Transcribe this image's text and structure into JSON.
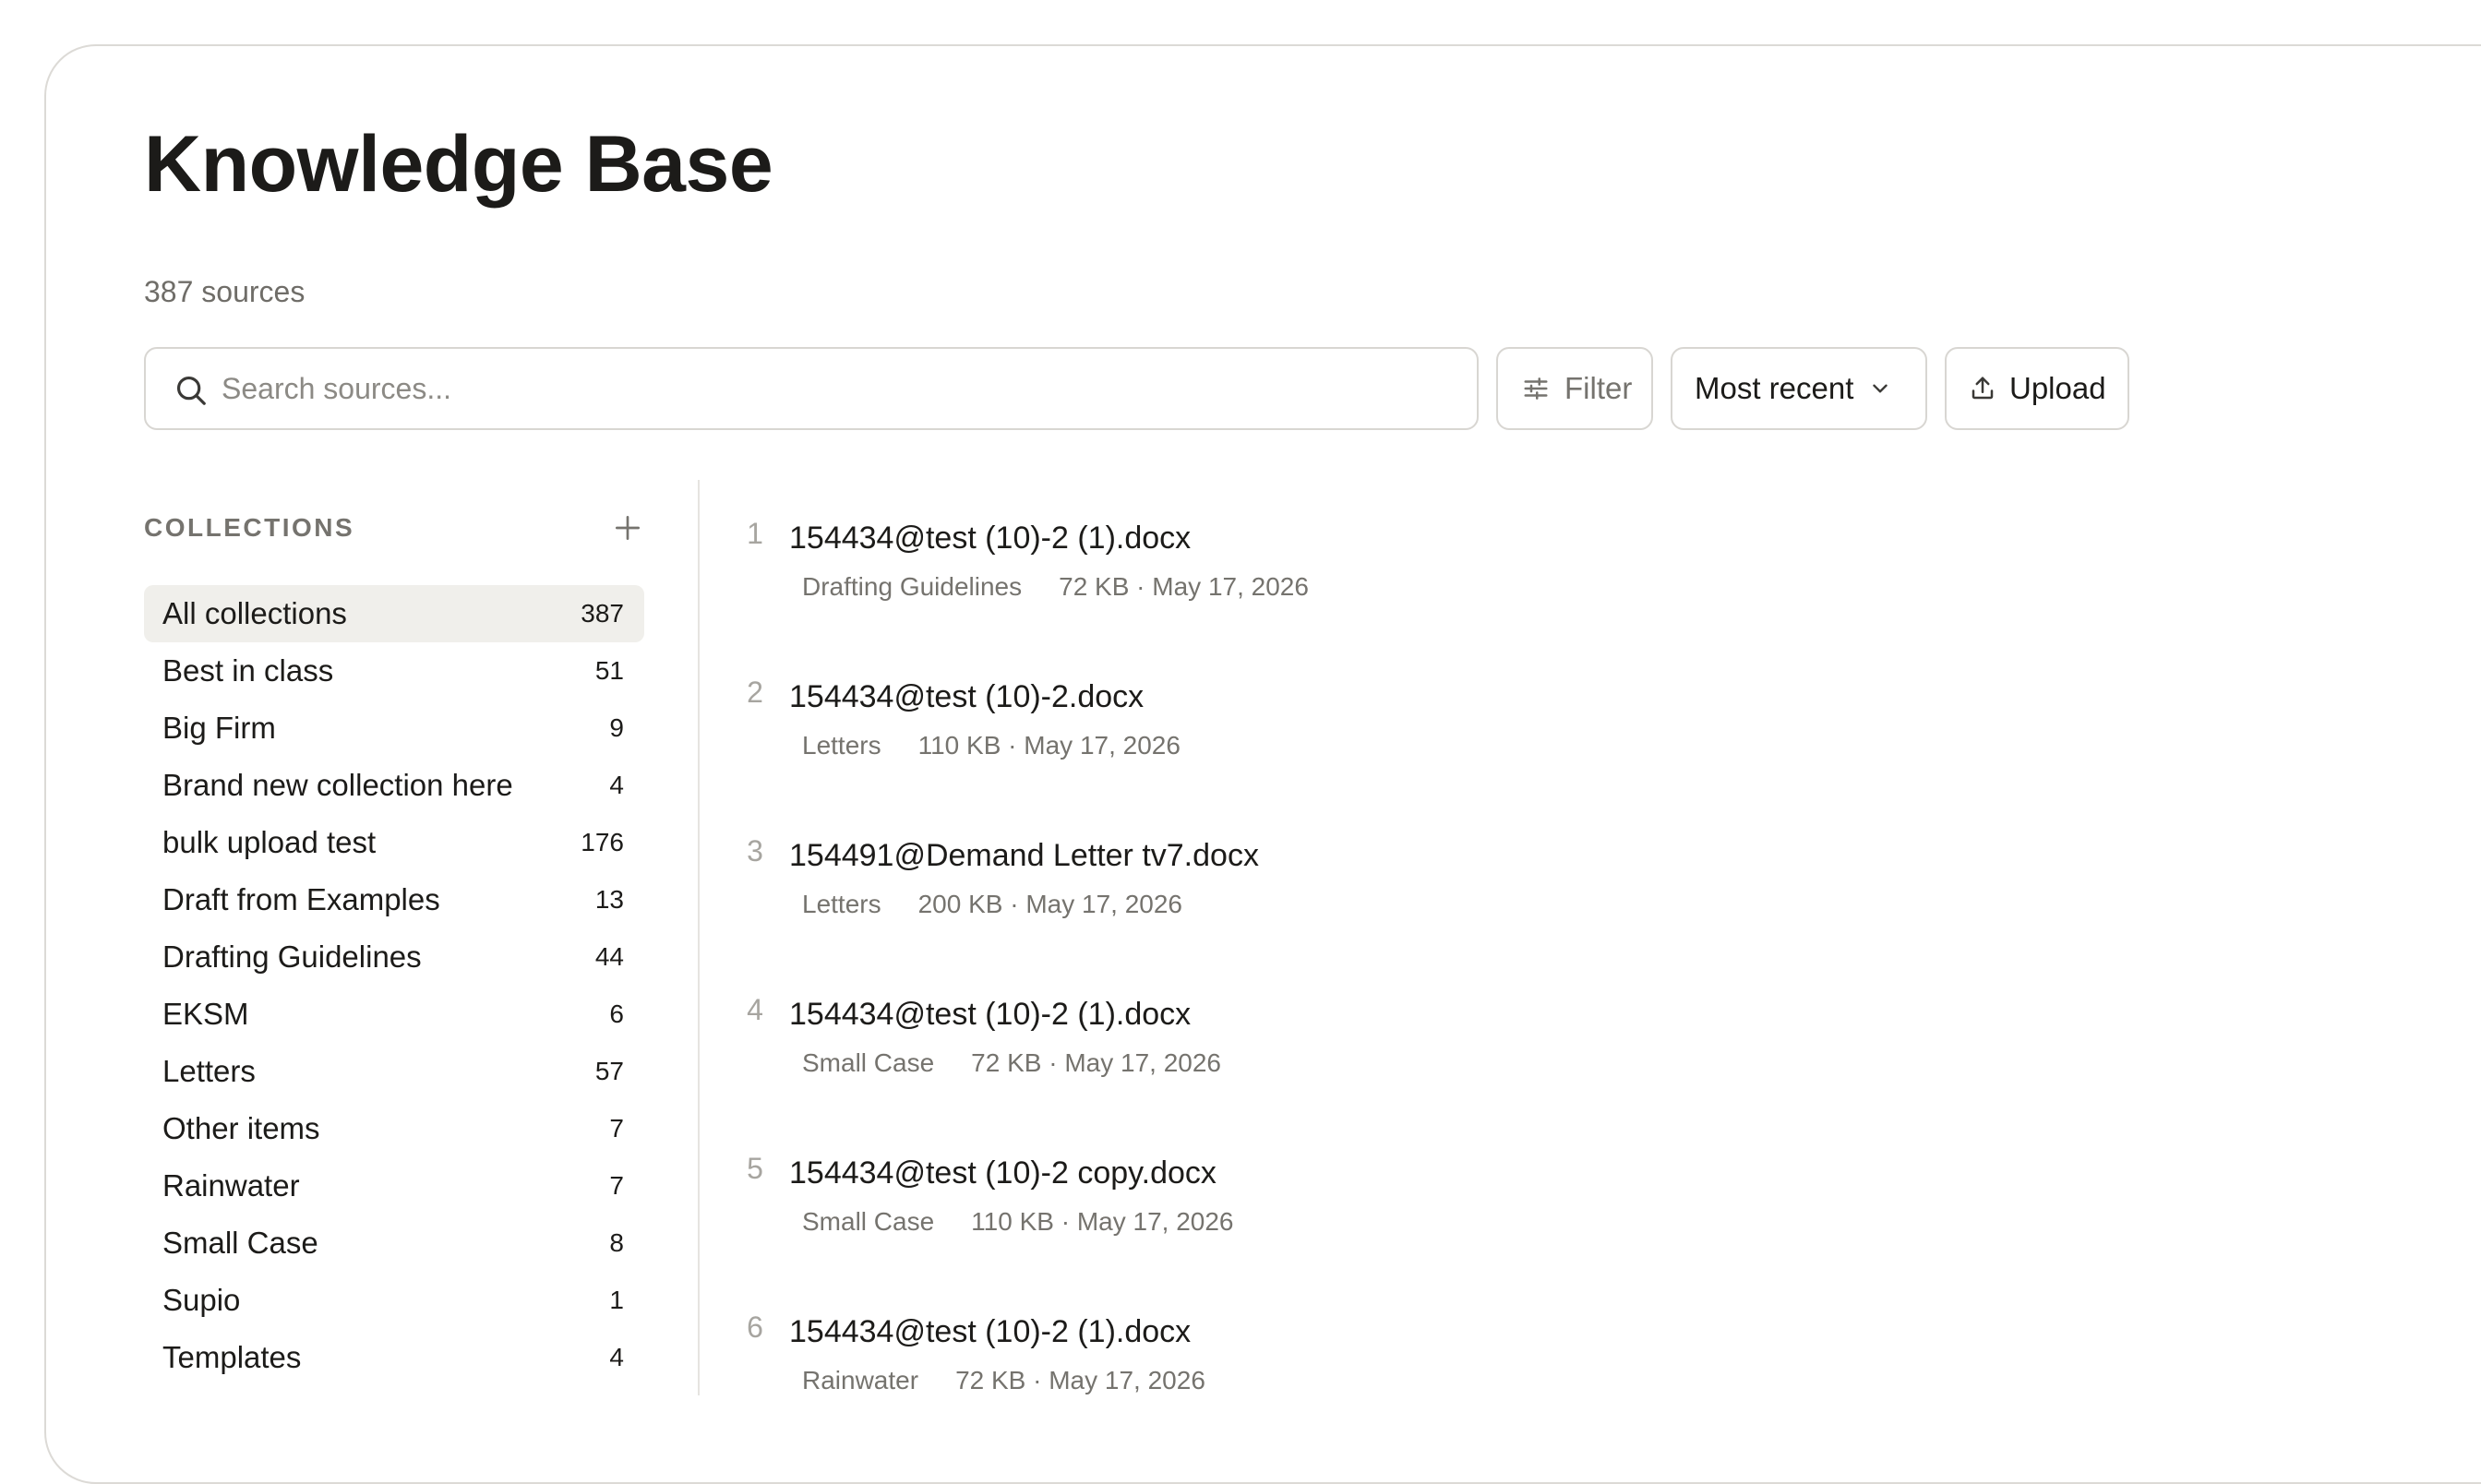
{
  "page": {
    "title": "Knowledge Base",
    "source_count": "387 sources"
  },
  "toolbar": {
    "search_placeholder": "Search sources...",
    "filter_label": "Filter",
    "sort_label": "Most recent",
    "upload_label": "Upload"
  },
  "sidebar": {
    "header": "COLLECTIONS",
    "items": [
      {
        "label": "All collections",
        "count": "387"
      },
      {
        "label": "Best in class",
        "count": "51"
      },
      {
        "label": "Big Firm",
        "count": "9"
      },
      {
        "label": "Brand new collection here",
        "count": "4"
      },
      {
        "label": "bulk upload test",
        "count": "176"
      },
      {
        "label": "Draft from Examples",
        "count": "13"
      },
      {
        "label": "Drafting Guidelines",
        "count": "44"
      },
      {
        "label": "EKSM",
        "count": "6"
      },
      {
        "label": "Letters",
        "count": "57"
      },
      {
        "label": "Other items",
        "count": "7"
      },
      {
        "label": "Rainwater",
        "count": "7"
      },
      {
        "label": "Small Case",
        "count": "8"
      },
      {
        "label": "Supio",
        "count": "1"
      },
      {
        "label": "Templates",
        "count": "4"
      }
    ]
  },
  "documents": [
    {
      "index": "1",
      "name": "154434@test (10)-2 (1).docx",
      "collection": "Drafting Guidelines",
      "info": "72 KB · May 17, 2026"
    },
    {
      "index": "2",
      "name": "154434@test (10)-2.docx",
      "collection": "Letters",
      "info": "110 KB · May 17, 2026"
    },
    {
      "index": "3",
      "name": "154491@Demand Letter tv7.docx",
      "collection": "Letters",
      "info": "200 KB · May 17, 2026"
    },
    {
      "index": "4",
      "name": "154434@test (10)-2 (1).docx",
      "collection": "Small Case",
      "info": "72 KB · May 17, 2026"
    },
    {
      "index": "5",
      "name": "154434@test (10)-2 copy.docx",
      "collection": "Small Case",
      "info": "110 KB · May 17, 2026"
    },
    {
      "index": "6",
      "name": "154434@test (10)-2 (1).docx",
      "collection": "Rainwater",
      "info": "72 KB · May 17, 2026"
    }
  ]
}
